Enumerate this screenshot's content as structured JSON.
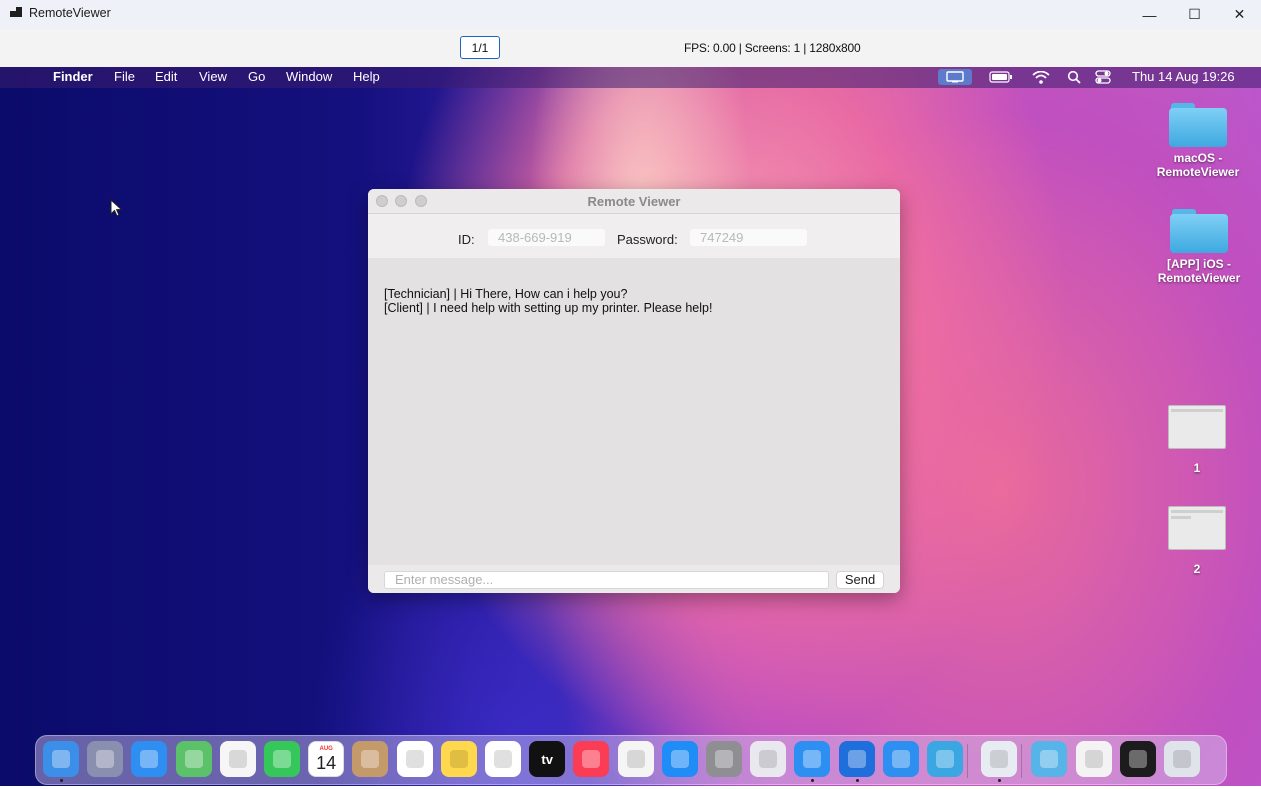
{
  "window": {
    "title": "RemoteViewer",
    "minimize_glyph": "—",
    "maximize_glyph": "☐",
    "close_glyph": "✕"
  },
  "toolbar": {
    "pager": "1/1",
    "status": "FPS: 0.00 | Screens: 1 | 1280x800"
  },
  "mac": {
    "menubar": {
      "apple_glyph": "",
      "items": [
        "Finder",
        "File",
        "Edit",
        "View",
        "Go",
        "Window",
        "Help"
      ],
      "clock": "Thu 14 Aug  19:26",
      "status_icons": [
        "screen-mirror-icon",
        "battery-icon",
        "wifi-icon",
        "spotlight-search-icon",
        "control-center-icon"
      ]
    },
    "desktop_icons": [
      {
        "label": "macOS - RemoteViewer",
        "icon": "folder-icon"
      },
      {
        "label": "[APP] iOS - RemoteViewer",
        "icon": "folder-icon"
      },
      {
        "label": "1",
        "icon": "screenshot-icon"
      },
      {
        "label": "2",
        "icon": "screenshot-icon"
      }
    ],
    "remote_viewer": {
      "title": "Remote Viewer",
      "id_label": "ID:",
      "id_value": "438-669-919",
      "password_label": "Password:",
      "password_value": "747249",
      "messages": [
        "[Technician] | Hi There, How can i help you?",
        "[Client] | I need help with setting up my printer. Please help!"
      ],
      "message_placeholder": "Enter message...",
      "send_label": "Send"
    },
    "dock": {
      "items": [
        {
          "name": "finder",
          "icon": "finder-icon",
          "color": "#3b8fe8",
          "running": true
        },
        {
          "name": "launchpad",
          "icon": "launchpad-icon",
          "color": "#8a8fb0",
          "running": false
        },
        {
          "name": "mail",
          "icon": "mail-icon",
          "color": "#2f8ef2",
          "running": false
        },
        {
          "name": "maps",
          "icon": "maps-icon",
          "color": "#5cc26a",
          "running": false
        },
        {
          "name": "photos",
          "icon": "photos-icon",
          "color": "#f6f6f6",
          "running": false
        },
        {
          "name": "facetime",
          "icon": "facetime-icon",
          "color": "#35c759",
          "running": false
        },
        {
          "name": "calendar",
          "icon": "calendar-icon",
          "color": "#ffffff",
          "running": false,
          "calendar_month": "AUG",
          "calendar_day": "14"
        },
        {
          "name": "contacts",
          "icon": "contacts-icon",
          "color": "#c59a6b",
          "running": false
        },
        {
          "name": "reminders",
          "icon": "reminders-icon",
          "color": "#ffffff",
          "running": false
        },
        {
          "name": "notes",
          "icon": "notes-icon",
          "color": "#ffd84d",
          "running": false
        },
        {
          "name": "freeform",
          "icon": "freeform-icon",
          "color": "#ffffff",
          "running": false
        },
        {
          "name": "apple-tv",
          "icon": "tv-icon",
          "color": "#111111",
          "running": false,
          "text": "tv"
        },
        {
          "name": "music",
          "icon": "music-icon",
          "color": "#fa3c55",
          "running": false
        },
        {
          "name": "news",
          "icon": "news-icon",
          "color": "#f5f5f5",
          "running": false
        },
        {
          "name": "app-store",
          "icon": "app-store-icon",
          "color": "#1f8df5",
          "running": false
        },
        {
          "name": "system-settings",
          "icon": "settings-icon",
          "color": "#8e8e93",
          "running": false
        },
        {
          "name": "iphone-mirroring",
          "icon": "iphone-mirroring-icon",
          "color": "#e8e8ee",
          "running": false
        },
        {
          "name": "safari",
          "icon": "safari-icon",
          "color": "#2e8ff3",
          "running": true
        },
        {
          "name": "xcode",
          "icon": "xcode-icon",
          "color": "#1e6fdb",
          "running": true
        },
        {
          "name": "xcode-instruments",
          "icon": "instruments-icon",
          "color": "#2d8ff0",
          "running": false
        },
        {
          "name": "remoteviewer-app",
          "icon": "remoteviewer-app-icon",
          "color": "#3aa7e3",
          "running": false
        },
        {
          "name": "preview",
          "icon": "preview-icon",
          "color": "#e7ecf2",
          "running": true
        },
        {
          "name": "downloads",
          "icon": "downloads-folder-icon",
          "color": "#56b4e9",
          "running": false
        },
        {
          "name": "recent-window",
          "icon": "window-thumbnail-icon",
          "color": "#f3f3f3",
          "running": false
        },
        {
          "name": "terminal",
          "icon": "terminal-icon",
          "color": "#1c1c1c",
          "running": false
        },
        {
          "name": "trash",
          "icon": "trash-icon",
          "color": "#dfe3ea",
          "running": false
        }
      ]
    }
  }
}
